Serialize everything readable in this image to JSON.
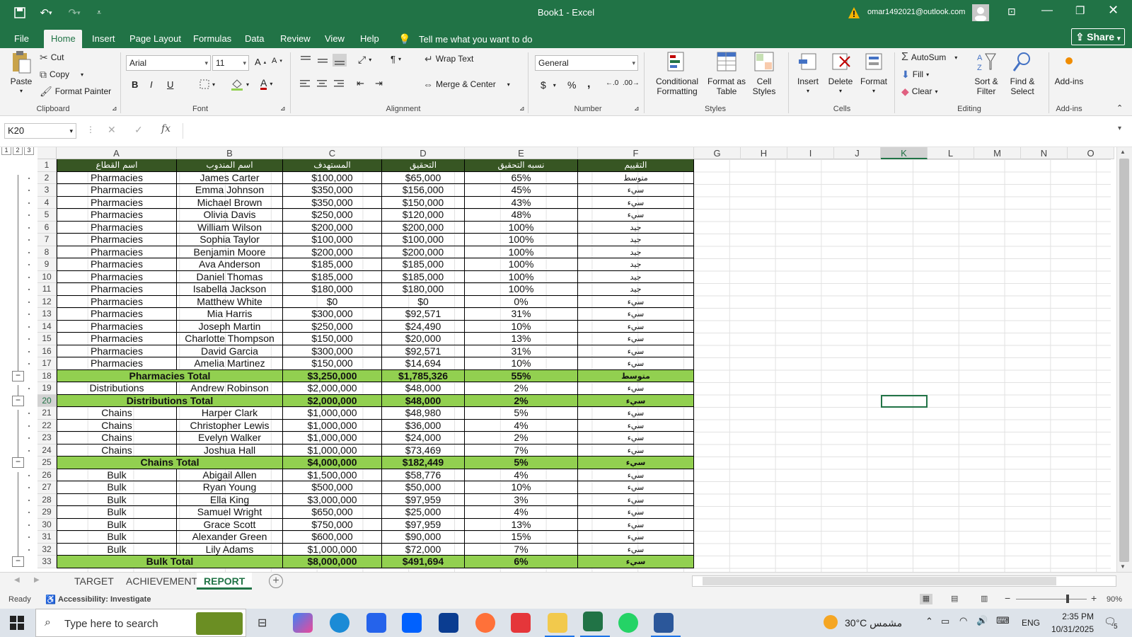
{
  "titlebar": {
    "title": "Book1  -  Excel",
    "account": "omar1492021@outlook.com",
    "share": "Share"
  },
  "tabs": [
    "File",
    "Home",
    "Insert",
    "Page Layout",
    "Formulas",
    "Data",
    "Review",
    "View",
    "Help"
  ],
  "tell_me": "Tell me what you want to do",
  "clipboard": {
    "paste": "Paste",
    "cut": "Cut",
    "copy": "Copy",
    "format_painter": "Format Painter",
    "label": "Clipboard"
  },
  "font": {
    "name": "Arial",
    "size": "11",
    "label": "Font",
    "bold": "B",
    "italic": "I",
    "underline": "U"
  },
  "alignment": {
    "wrap": "Wrap Text",
    "merge": "Merge & Center",
    "label": "Alignment"
  },
  "number": {
    "format": "General",
    "currency": "$",
    "percent": "%",
    "comma": ",",
    "label": "Number"
  },
  "styles": {
    "conditional": "Conditional Formatting",
    "format_table": "Format as Table",
    "cell_styles": "Cell Styles",
    "label": "Styles"
  },
  "cells_grp": {
    "insert": "Insert",
    "delete": "Delete",
    "format": "Format",
    "label": "Cells"
  },
  "editing": {
    "autosum": "AutoSum",
    "fill": "Fill",
    "clear": "Clear",
    "sort": "Sort & Filter",
    "find": "Find & Select",
    "label": "Editing"
  },
  "addins": {
    "btn": "Add-ins",
    "label": "Add-ins"
  },
  "formula": {
    "namebox": "K20",
    "fx": "fx"
  },
  "columns": [
    "A",
    "B",
    "C",
    "D",
    "E",
    "F",
    "G",
    "H",
    "I",
    "J",
    "K",
    "L",
    "M",
    "N",
    "O"
  ],
  "header_row": [
    "اسم القطاع",
    "اسم المندوب",
    "المستهدف",
    "التحقيق",
    "نسبه التحقيق",
    "التقييم"
  ],
  "rows": [
    {
      "n": "2",
      "t": "d",
      "v": [
        "Pharmacies",
        "James Carter",
        "$100,000",
        "$65,000",
        "65%",
        "متوسط"
      ]
    },
    {
      "n": "3",
      "t": "d",
      "v": [
        "Pharmacies",
        "Emma Johnson",
        "$350,000",
        "$156,000",
        "45%",
        "سيء"
      ]
    },
    {
      "n": "4",
      "t": "d",
      "v": [
        "Pharmacies",
        "Michael Brown",
        "$350,000",
        "$150,000",
        "43%",
        "سيء"
      ]
    },
    {
      "n": "5",
      "t": "d",
      "v": [
        "Pharmacies",
        "Olivia Davis",
        "$250,000",
        "$120,000",
        "48%",
        "سيء"
      ]
    },
    {
      "n": "6",
      "t": "d",
      "v": [
        "Pharmacies",
        "William Wilson",
        "$200,000",
        "$200,000",
        "100%",
        "جيد"
      ]
    },
    {
      "n": "7",
      "t": "d",
      "v": [
        "Pharmacies",
        "Sophia Taylor",
        "$100,000",
        "$100,000",
        "100%",
        "جيد"
      ]
    },
    {
      "n": "8",
      "t": "d",
      "v": [
        "Pharmacies",
        "Benjamin Moore",
        "$200,000",
        "$200,000",
        "100%",
        "جيد"
      ]
    },
    {
      "n": "9",
      "t": "d",
      "v": [
        "Pharmacies",
        "Ava Anderson",
        "$185,000",
        "$185,000",
        "100%",
        "جيد"
      ]
    },
    {
      "n": "10",
      "t": "d",
      "v": [
        "Pharmacies",
        "Daniel Thomas",
        "$185,000",
        "$185,000",
        "100%",
        "جيد"
      ]
    },
    {
      "n": "11",
      "t": "d",
      "v": [
        "Pharmacies",
        "Isabella Jackson",
        "$180,000",
        "$180,000",
        "100%",
        "جيد"
      ]
    },
    {
      "n": "12",
      "t": "d",
      "v": [
        "Pharmacies",
        "Matthew White",
        "$0",
        "$0",
        "0%",
        "سيء"
      ]
    },
    {
      "n": "13",
      "t": "d",
      "v": [
        "Pharmacies",
        "Mia Harris",
        "$300,000",
        "$92,571",
        "31%",
        "سيء"
      ]
    },
    {
      "n": "14",
      "t": "d",
      "v": [
        "Pharmacies",
        "Joseph Martin",
        "$250,000",
        "$24,490",
        "10%",
        "سيء"
      ]
    },
    {
      "n": "15",
      "t": "d",
      "v": [
        "Pharmacies",
        "Charlotte Thompson",
        "$150,000",
        "$20,000",
        "13%",
        "سيء"
      ]
    },
    {
      "n": "16",
      "t": "d",
      "v": [
        "Pharmacies",
        "David Garcia",
        "$300,000",
        "$92,571",
        "31%",
        "سيء"
      ]
    },
    {
      "n": "17",
      "t": "d",
      "v": [
        "Pharmacies",
        "Amelia Martinez",
        "$150,000",
        "$14,694",
        "10%",
        "سيء"
      ]
    },
    {
      "n": "18",
      "t": "t",
      "v": [
        "Pharmacies Total",
        "$3,250,000",
        "$1,785,326",
        "55%",
        "متوسط"
      ]
    },
    {
      "n": "19",
      "t": "d",
      "v": [
        "Distributions",
        "Andrew Robinson",
        "$2,000,000",
        "$48,000",
        "2%",
        "سيء"
      ]
    },
    {
      "n": "20",
      "t": "t",
      "v": [
        "Distributions Total",
        "$2,000,000",
        "$48,000",
        "2%",
        "سيء"
      ]
    },
    {
      "n": "21",
      "t": "d",
      "v": [
        "Chains",
        "Harper Clark",
        "$1,000,000",
        "$48,980",
        "5%",
        "سيء"
      ]
    },
    {
      "n": "22",
      "t": "d",
      "v": [
        "Chains",
        "Christopher Lewis",
        "$1,000,000",
        "$36,000",
        "4%",
        "سيء"
      ]
    },
    {
      "n": "23",
      "t": "d",
      "v": [
        "Chains",
        "Evelyn Walker",
        "$1,000,000",
        "$24,000",
        "2%",
        "سيء"
      ]
    },
    {
      "n": "24",
      "t": "d",
      "v": [
        "Chains",
        "Joshua Hall",
        "$1,000,000",
        "$73,469",
        "7%",
        "سيء"
      ]
    },
    {
      "n": "25",
      "t": "t",
      "v": [
        "Chains Total",
        "$4,000,000",
        "$182,449",
        "5%",
        "سيء"
      ]
    },
    {
      "n": "26",
      "t": "d",
      "v": [
        "Bulk",
        "Abigail Allen",
        "$1,500,000",
        "$58,776",
        "4%",
        "سيء"
      ]
    },
    {
      "n": "27",
      "t": "d",
      "v": [
        "Bulk",
        "Ryan Young",
        "$500,000",
        "$50,000",
        "10%",
        "سيء"
      ]
    },
    {
      "n": "28",
      "t": "d",
      "v": [
        "Bulk",
        "Ella King",
        "$3,000,000",
        "$97,959",
        "3%",
        "سيء"
      ]
    },
    {
      "n": "29",
      "t": "d",
      "v": [
        "Bulk",
        "Samuel Wright",
        "$650,000",
        "$25,000",
        "4%",
        "سيء"
      ]
    },
    {
      "n": "30",
      "t": "d",
      "v": [
        "Bulk",
        "Grace Scott",
        "$750,000",
        "$97,959",
        "13%",
        "سيء"
      ]
    },
    {
      "n": "31",
      "t": "d",
      "v": [
        "Bulk",
        "Alexander Green",
        "$600,000",
        "$90,000",
        "15%",
        "سيء"
      ]
    },
    {
      "n": "32",
      "t": "d",
      "v": [
        "Bulk",
        "Lily Adams",
        "$1,000,000",
        "$72,000",
        "7%",
        "سيء"
      ]
    },
    {
      "n": "33",
      "t": "t",
      "v": [
        "Bulk Total",
        "$8,000,000",
        "$491,694",
        "6%",
        "سيء"
      ]
    }
  ],
  "sheets": [
    "TARGET",
    "ACHIEVEMENT",
    "REPORT"
  ],
  "status": {
    "ready": "Ready",
    "accessibility": "Accessibility: Investigate",
    "zoom": "90%"
  },
  "taskbar": {
    "search": "Type here to search",
    "weather": "30°C  مشمس",
    "lang": "ENG",
    "time": "2:35 PM",
    "date": "10/31/2025",
    "notif": "5"
  },
  "colors": {
    "excel_green": "#217346",
    "header_fill": "#375623",
    "total_fill": "#92d050"
  }
}
